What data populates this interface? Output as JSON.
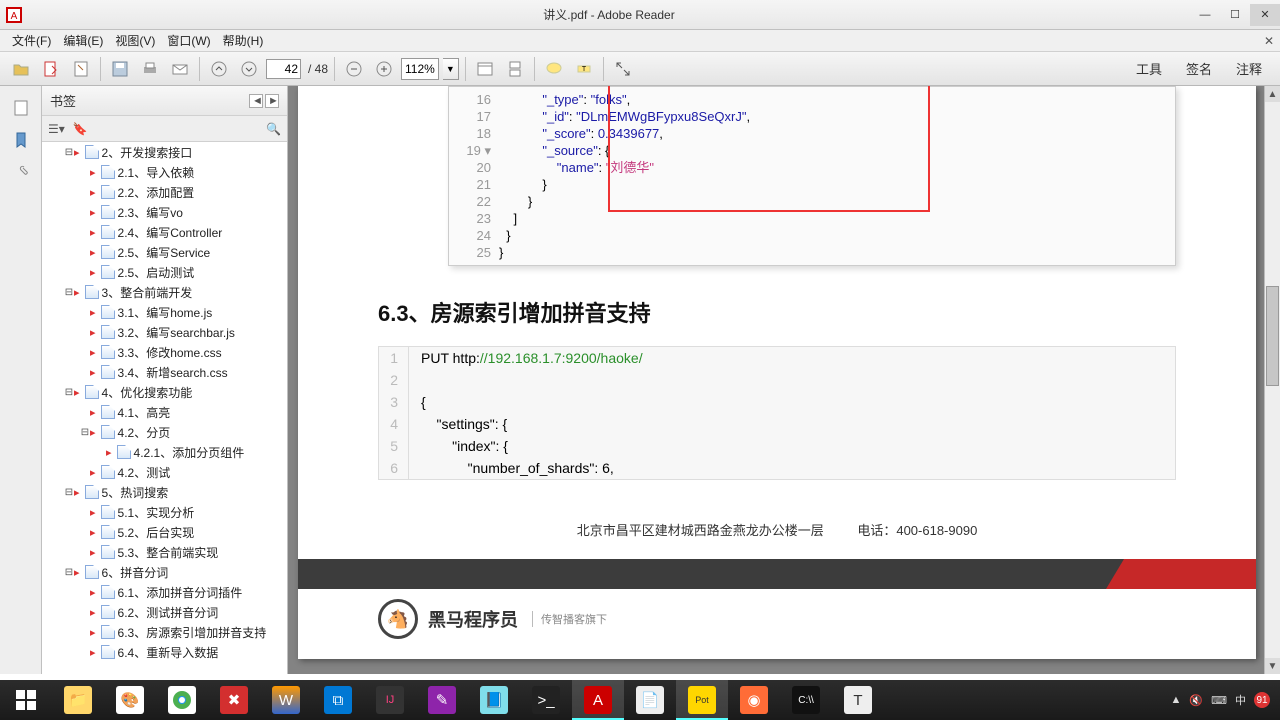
{
  "window": {
    "title": "讲义.pdf - Adobe Reader"
  },
  "menu": {
    "file": "文件(F)",
    "edit": "编辑(E)",
    "view": "视图(V)",
    "window": "窗口(W)",
    "help": "帮助(H)"
  },
  "toolbar": {
    "page_current": "42",
    "page_total": "/ 48",
    "zoom": "112%",
    "tools": "工具",
    "sign": "签名",
    "comment": "注释"
  },
  "bookmarks": {
    "title": "书签",
    "items": [
      {
        "level": 1,
        "expand": "⊟",
        "text": "2、开发搜索接口"
      },
      {
        "level": 2,
        "text": "2.1、导入依赖"
      },
      {
        "level": 2,
        "text": "2.2、添加配置"
      },
      {
        "level": 2,
        "text": "2.3、编写vo"
      },
      {
        "level": 2,
        "text": "2.4、编写Controller"
      },
      {
        "level": 2,
        "text": "2.5、编写Service"
      },
      {
        "level": 2,
        "text": "2.5、启动测试"
      },
      {
        "level": 1,
        "expand": "⊟",
        "text": "3、整合前端开发"
      },
      {
        "level": 2,
        "text": "3.1、编写home.js"
      },
      {
        "level": 2,
        "text": "3.2、编写searchbar.js"
      },
      {
        "level": 2,
        "text": "3.3、修改home.css"
      },
      {
        "level": 2,
        "text": "3.4、新增search.css"
      },
      {
        "level": 1,
        "expand": "⊟",
        "text": "4、优化搜索功能"
      },
      {
        "level": 2,
        "text": "4.1、高亮"
      },
      {
        "level": 2,
        "expand": "⊟",
        "text": "4.2、分页"
      },
      {
        "level": 3,
        "text": "4.2.1、添加分页组件"
      },
      {
        "level": 2,
        "text": "4.2、测试"
      },
      {
        "level": 1,
        "expand": "⊟",
        "text": "5、热词搜索"
      },
      {
        "level": 2,
        "text": "5.1、实现分析"
      },
      {
        "level": 2,
        "text": "5.2、后台实现"
      },
      {
        "level": 2,
        "text": "5.3、整合前端实现"
      },
      {
        "level": 1,
        "expand": "⊟",
        "text": "6、拼音分词"
      },
      {
        "level": 2,
        "text": "6.1、添加拼音分词插件"
      },
      {
        "level": 2,
        "text": "6.2、测试拼音分词"
      },
      {
        "level": 2,
        "text": "6.3、房源索引增加拼音支持"
      },
      {
        "level": 2,
        "text": "6.4、重新导入数据"
      }
    ]
  },
  "code1": {
    "lines": [
      {
        "n": "16",
        "html": "            <span class='c-str'>\"_type\"</span>: <span class='c-str'>\"folks\"</span>,"
      },
      {
        "n": "17",
        "html": "            <span class='c-str'>\"_id\"</span>: <span class='c-str'>\"DLmEMWgBFypxu8SeQxrJ\"</span>,"
      },
      {
        "n": "18",
        "html": "            <span class='c-str'>\"_score\"</span>: <span class='c-num'>0.3439677</span>,"
      },
      {
        "n": "19 ▾",
        "html": "            <span class='c-str'>\"_source\"</span>: {"
      },
      {
        "n": "20",
        "html": "                <span class='c-str'>\"name\"</span>: <span class='c-str-cn'>\"刘德华\"</span>"
      },
      {
        "n": "21",
        "html": "            }"
      },
      {
        "n": "22",
        "html": "        }"
      },
      {
        "n": "23",
        "html": "    ]"
      },
      {
        "n": "24",
        "html": "  }"
      },
      {
        "n": "25",
        "html": "}"
      }
    ]
  },
  "section_heading": "6.3、房源索引增加拼音支持",
  "code2": {
    "lines": [
      {
        "n": "1",
        "html": "PUT http:<span class='c2-url'>//192.168.1.7:9200/haoke/</span>"
      },
      {
        "n": "2",
        "html": ""
      },
      {
        "n": "3",
        "html": "{"
      },
      {
        "n": "4",
        "html": "    \"settings\": {"
      },
      {
        "n": "5",
        "html": "        \"index\": {"
      },
      {
        "n": "6",
        "html": "            \"number_of_shards\": 6,"
      }
    ]
  },
  "footer": {
    "address": "北京市昌平区建材城西路金燕龙办公楼一层",
    "phone_label": "电话：",
    "phone": "400-618-9090"
  },
  "page2": {
    "logo_text": "黑马程序员",
    "logo_sub": "传智播客旗下"
  },
  "tray": {
    "ime": "中",
    "battery": "91"
  }
}
